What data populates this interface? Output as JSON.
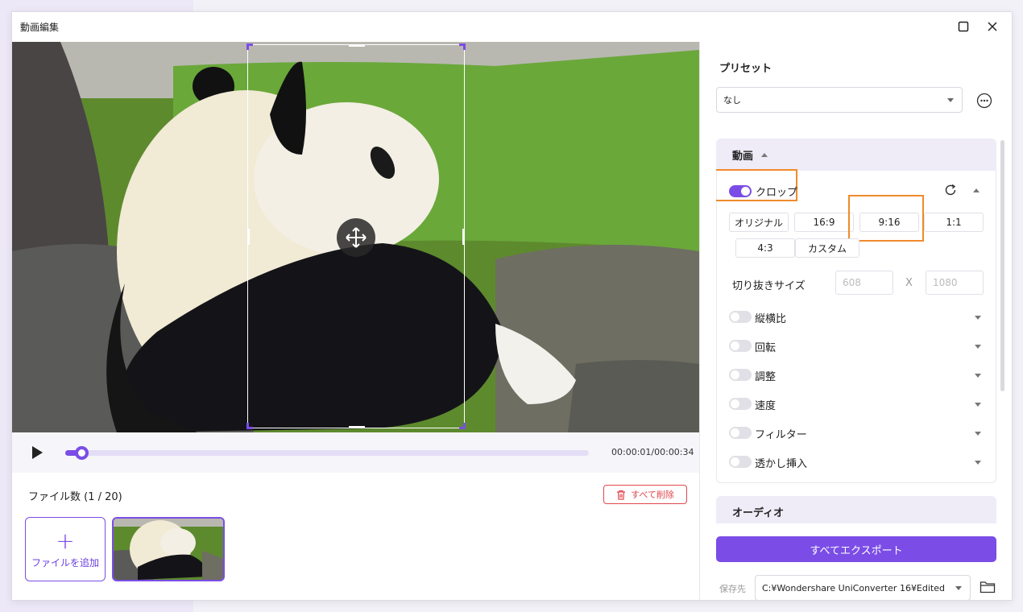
{
  "window": {
    "title": "動画編集"
  },
  "player": {
    "timecode": "00:00:01/00:00:34",
    "progress_fraction": 0.03
  },
  "files": {
    "count_label": "ファイル数 (1 / 20)",
    "delete_all_label": "すべて削除",
    "add_file_label": "ファイルを追加"
  },
  "panel": {
    "preset_title": "プリセット",
    "preset_value": "なし",
    "video_section_title": "動画",
    "crop_label": "クロップ",
    "ratios": [
      "オリジナル",
      "16:9",
      "9:16",
      "1:1",
      "4:3",
      "カスタム"
    ],
    "crop_size_label": "切り抜きサイズ",
    "crop_width": "608",
    "crop_x": "X",
    "crop_height": "1080",
    "options": [
      "縦横比",
      "回転",
      "調整",
      "速度",
      "フィルター",
      "透かし挿入"
    ],
    "audio_section_title": "オーディオ",
    "export_all_label": "すべてエクスポート",
    "save_to_label": "保存先",
    "save_path": "C:¥Wondershare UniConverter 16¥Edited"
  },
  "colors": {
    "accent": "#7b4de6",
    "highlight": "#f08a2c",
    "danger": "#e0474c"
  }
}
